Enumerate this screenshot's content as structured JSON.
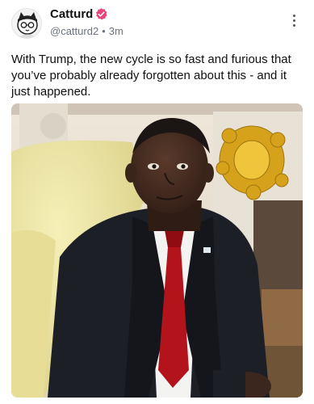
{
  "post": {
    "author": {
      "display_name": "Catturd",
      "handle": "@catturd2",
      "time": "3m",
      "verified_badge": "verified-check-icon",
      "badge_color": "#e8457d",
      "avatar_icon": "cat-avatar-icon"
    },
    "menu_icon": "more-vertical-icon",
    "text": "With Trump, the new cycle is so fast and furious that you’ve probably already forgotten about this - and it just happened.",
    "media": {
      "type": "video-still",
      "description_icon": "media-image"
    }
  }
}
